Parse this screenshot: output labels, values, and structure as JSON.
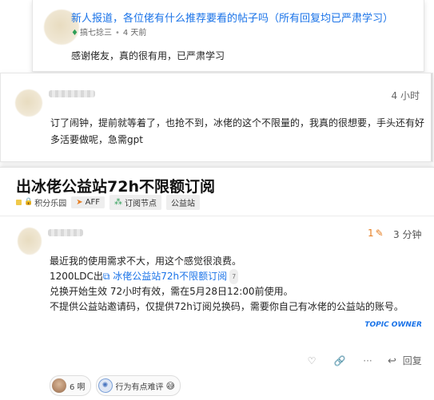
{
  "post1": {
    "title": "新人报道，各位佬有什么推荐要看的帖子吗（所有回复均已严肃学习）",
    "meta_author": "搞七捻三",
    "meta_time": "4 天前",
    "body": "感谢佬友，真的很有用，已严肃学习"
  },
  "post2": {
    "time": "4 小时",
    "body": "订了闹钟，提前就等着了，也抢不到，冰佬的这个不限量的，我真的很想要，手头还有好多活要做呢，急需gpt"
  },
  "topic": {
    "title": "出冰佬公益站72h不限额订阅",
    "category": "积分乐园",
    "tags": [
      "AFF",
      "订阅节点",
      "公益站"
    ]
  },
  "post3": {
    "reply_count": "1",
    "time": "3 分钟",
    "line1": "最近我的使用需求不大，用这个感觉很浪费。",
    "line2_prefix": "1200LDC出",
    "line2_link": "冰佬公益站72h不限额订阅",
    "line2_badge": "7",
    "line3": "兑换开始生效 72小时有效，需在5月28日12:00前使用。",
    "line4": "不提供公益站邀请码，仅提供72h订阅兑换码，需要你自己有冰佬的公益站的账号。",
    "owner_label": "TOPIC OWNER",
    "reply_label": "回复"
  },
  "chips": [
    {
      "label": "6 啊",
      "icon": "user-avatar"
    },
    {
      "label": "行为有点难评",
      "icon": "badge-icon",
      "emoji": "😅"
    }
  ],
  "colors": {
    "link": "#1a73e8",
    "accent": "#e67e22",
    "owner": "#1a73e8"
  }
}
